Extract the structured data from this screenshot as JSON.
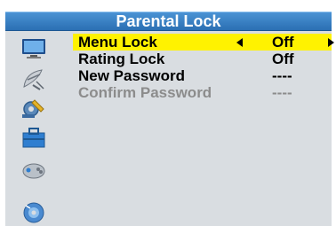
{
  "window": {
    "title": "Parental Lock"
  },
  "sidebar": {
    "icons": [
      "tv-monitor-icon",
      "satellite-dish-icon",
      "wrench-gear-icon",
      "toolbox-icon",
      "gamepad-icon",
      "media-disc-icon"
    ]
  },
  "menu": {
    "items": [
      {
        "label": "Menu Lock",
        "value": "Off"
      },
      {
        "label": "Rating Lock",
        "value": "Off"
      },
      {
        "label": "New Password",
        "value": "----"
      },
      {
        "label": "Confirm Password",
        "value": "----"
      }
    ],
    "selected_index": 0
  },
  "colors": {
    "title_bar": "#2b6fb3",
    "panel_background": "#d9dde1",
    "selection_highlight": "#fff200",
    "disabled_text": "#8c8c8c"
  }
}
